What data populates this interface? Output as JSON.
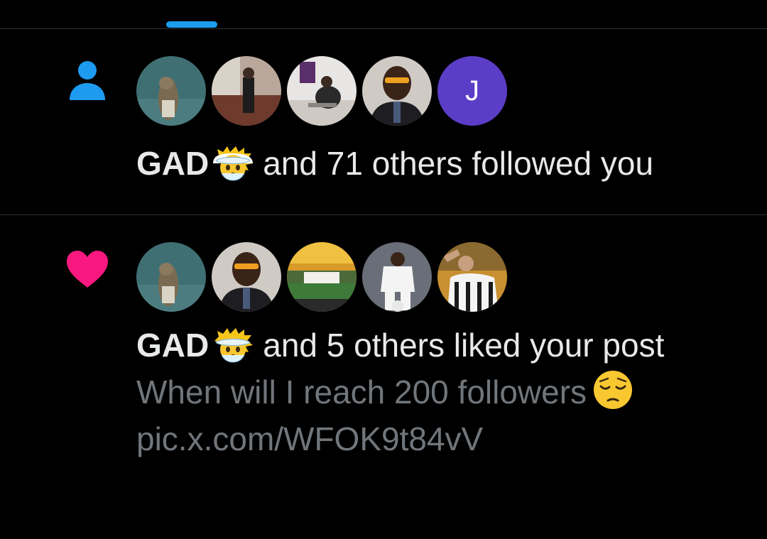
{
  "tabs": {
    "active_indicator_color": "#1d9bf0"
  },
  "notifications": [
    {
      "type": "follow",
      "icon": "person-icon",
      "icon_color": "#1d9bf0",
      "avatars": [
        {
          "kind": "photo",
          "label": "avatar-bird"
        },
        {
          "kind": "photo",
          "label": "avatar-room"
        },
        {
          "kind": "photo",
          "label": "avatar-desk"
        },
        {
          "kind": "photo",
          "label": "avatar-suit"
        },
        {
          "kind": "letter",
          "letter": "J",
          "color": "#5b3dc8"
        }
      ],
      "actor_name": "GAD",
      "actor_emoji": "exploding-head-emoji",
      "action_text": "and 71 others followed you"
    },
    {
      "type": "like",
      "icon": "heart-icon",
      "icon_color": "#f91880",
      "avatars": [
        {
          "kind": "photo",
          "label": "avatar-bird"
        },
        {
          "kind": "photo",
          "label": "avatar-suit"
        },
        {
          "kind": "photo",
          "label": "avatar-landscape"
        },
        {
          "kind": "photo",
          "label": "avatar-footballer"
        },
        {
          "kind": "photo",
          "label": "avatar-dybala"
        }
      ],
      "actor_name": "GAD",
      "actor_emoji": "exploding-head-emoji",
      "action_text": "and 5 others liked your post",
      "post_text": "When will I reach 200 followers",
      "post_emoji": "pensive-face-emoji",
      "post_link": "pic.x.com/WFOK9t84vV"
    }
  ]
}
